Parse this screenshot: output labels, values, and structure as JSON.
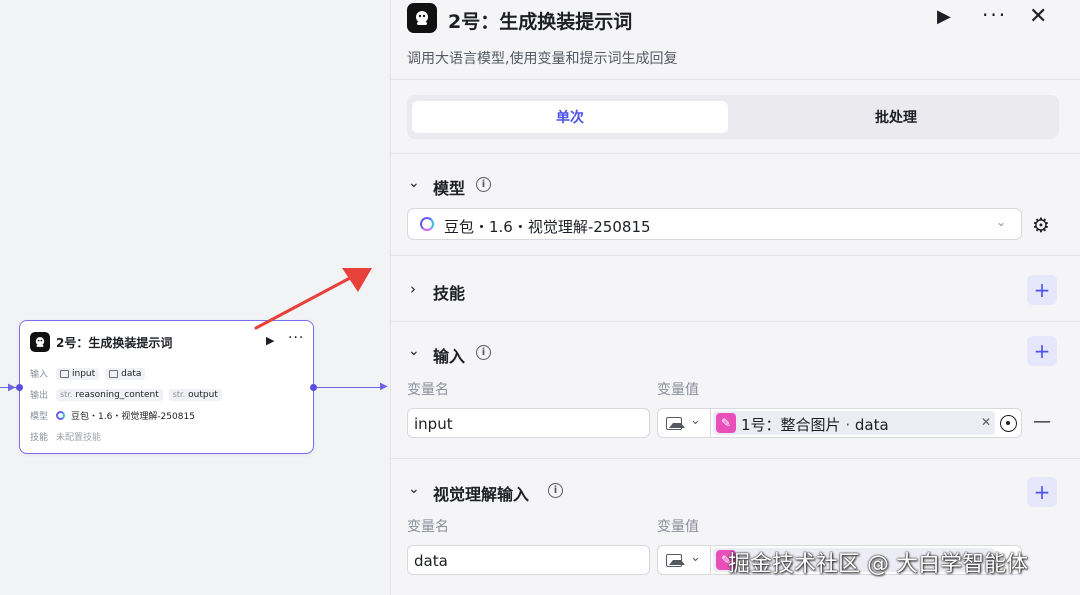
{
  "canvas": {
    "node": {
      "title": "2号：生成换装提示词",
      "run_icon": "▶",
      "more_icon": "···",
      "input_label": "输入",
      "inputs": [
        "input",
        "data"
      ],
      "output_label": "输出",
      "outputs": [
        {
          "type": "str.",
          "name": "reasoning_content"
        },
        {
          "type": "str.",
          "name": "output"
        }
      ],
      "model_label": "模型",
      "model_value": "豆包・1.6・视觉理解-250815",
      "skill_label": "技能",
      "skill_value": "未配置技能"
    }
  },
  "panel": {
    "title": "2号：生成换装提示词",
    "description": "调用大语言模型,使用变量和提示词生成回复",
    "run_icon": "▶",
    "more_icon": "···",
    "close_icon": "✕",
    "tabs": [
      {
        "label": "单次",
        "active": true
      },
      {
        "label": "批处理",
        "active": false
      }
    ],
    "model_section": {
      "title": "模型",
      "selected_model": "豆包・1.6・视觉理解-250815"
    },
    "skill_section": {
      "title": "技能"
    },
    "input_section": {
      "title": "输入",
      "name_header": "变量名",
      "value_header": "变量值",
      "row": {
        "name": "input",
        "ref_node": "1号：整合图片",
        "ref_var": "data"
      }
    },
    "vision_section": {
      "title": "视觉理解输入",
      "name_header": "变量名",
      "value_header": "变量值",
      "row": {
        "name": "data"
      }
    }
  },
  "watermark": "掘金技术社区 @ 大白学智能体",
  "colors": {
    "accent": "#4d53e8",
    "node_border": "#7a6ff0",
    "pink_chip": "#e84fb9",
    "arrow_red": "#e8413c"
  }
}
